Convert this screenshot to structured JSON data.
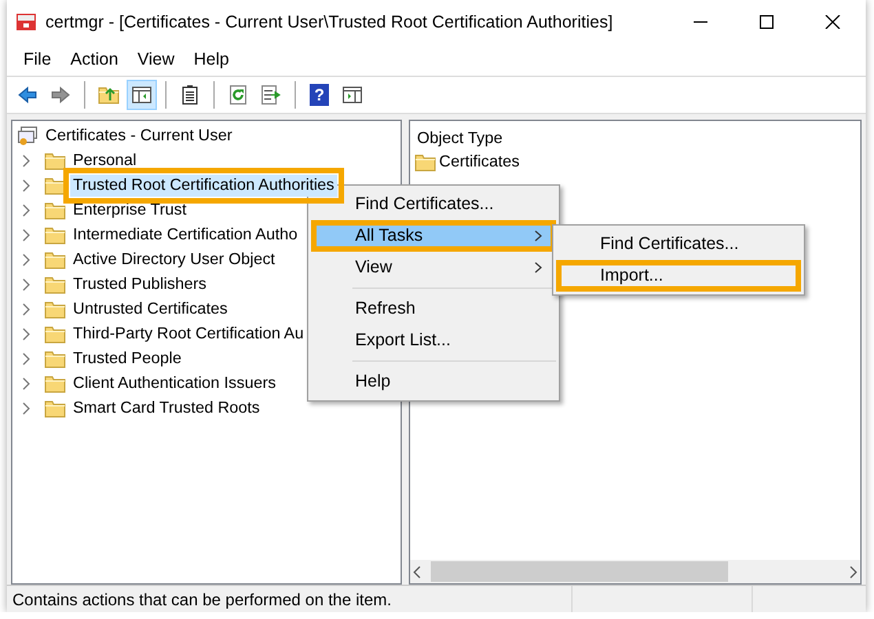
{
  "window": {
    "title": "certmgr - [Certificates - Current User\\Trusted Root Certification Authorities]"
  },
  "menu_bar": [
    "File",
    "Action",
    "View",
    "Help"
  ],
  "toolbar": [
    {
      "kind": "back",
      "disabled": false,
      "pressed": false
    },
    {
      "kind": "forward",
      "disabled": true,
      "pressed": false
    },
    {
      "kind": "separator"
    },
    {
      "kind": "up",
      "disabled": false,
      "pressed": false
    },
    {
      "kind": "console-tree",
      "disabled": false,
      "pressed": true
    },
    {
      "kind": "separator"
    },
    {
      "kind": "properties",
      "disabled": false,
      "pressed": false
    },
    {
      "kind": "separator"
    },
    {
      "kind": "refresh",
      "disabled": false,
      "pressed": false
    },
    {
      "kind": "export",
      "disabled": false,
      "pressed": false
    },
    {
      "kind": "separator"
    },
    {
      "kind": "help",
      "disabled": false,
      "pressed": false,
      "glyph": "?"
    },
    {
      "kind": "action-pane",
      "disabled": false,
      "pressed": false
    }
  ],
  "tree": {
    "label": "Certificates - Current User",
    "children": [
      {
        "label": "Personal",
        "selected": false,
        "highlighted": false
      },
      {
        "label": "Trusted Root Certification Authorities",
        "selected": true,
        "highlighted": true
      },
      {
        "label": "Enterprise Trust",
        "selected": false,
        "highlighted": false
      },
      {
        "label": "Intermediate Certification Autho",
        "selected": false,
        "highlighted": false
      },
      {
        "label": "Active Directory User Object",
        "selected": false,
        "highlighted": false
      },
      {
        "label": "Trusted Publishers",
        "selected": false,
        "highlighted": false
      },
      {
        "label": "Untrusted Certificates",
        "selected": false,
        "highlighted": false
      },
      {
        "label": "Third-Party Root Certification Au",
        "selected": false,
        "highlighted": false
      },
      {
        "label": "Trusted People",
        "selected": false,
        "highlighted": false
      },
      {
        "label": "Client Authentication Issuers",
        "selected": false,
        "highlighted": false
      },
      {
        "label": "Smart Card Trusted Roots",
        "selected": false,
        "highlighted": false
      }
    ]
  },
  "list": {
    "column": "Object Type",
    "items": [
      "Certificates"
    ]
  },
  "context_menu": [
    {
      "kind": "item",
      "label": "Find Certificates...",
      "selected": false,
      "highlighted": false,
      "has_submenu": false
    },
    {
      "kind": "item",
      "label": "All Tasks",
      "selected": true,
      "highlighted": true,
      "has_submenu": true
    },
    {
      "kind": "item",
      "label": "View",
      "selected": false,
      "highlighted": false,
      "has_submenu": true
    },
    {
      "kind": "separator"
    },
    {
      "kind": "item",
      "label": "Refresh",
      "selected": false,
      "highlighted": false,
      "has_submenu": false
    },
    {
      "kind": "item",
      "label": "Export List...",
      "selected": false,
      "highlighted": false,
      "has_submenu": false
    },
    {
      "kind": "separator"
    },
    {
      "kind": "item",
      "label": "Help",
      "selected": false,
      "highlighted": false,
      "has_submenu": false
    }
  ],
  "submenu": [
    {
      "kind": "item",
      "label": "Find Certificates...",
      "selected": false,
      "highlighted": false,
      "has_submenu": false
    },
    {
      "kind": "item",
      "label": "Import...",
      "selected": false,
      "highlighted": true,
      "has_submenu": false
    }
  ],
  "status_bar": "Contains actions that can be performed on the item."
}
